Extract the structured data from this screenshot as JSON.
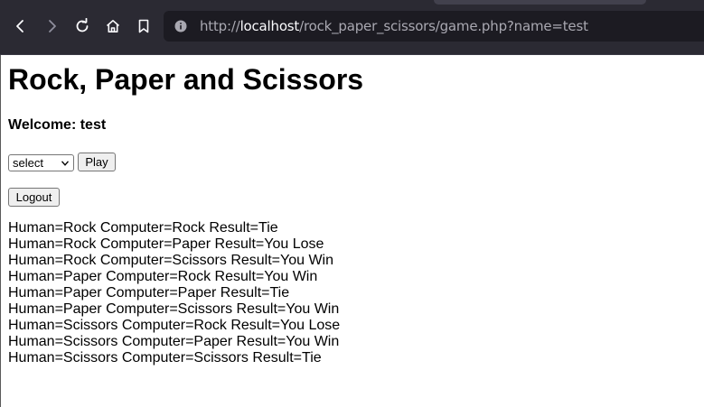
{
  "browser": {
    "url_prefix": "http://",
    "url_host": "localhost",
    "url_path": "/rock_paper_scissors/game.php?name=test"
  },
  "page": {
    "title": "Rock, Paper and Scissors",
    "welcome": "Welcome: test",
    "select_value": "select",
    "play_label": "Play",
    "logout_label": "Logout"
  },
  "results": [
    "Human=Rock Computer=Rock Result=Tie",
    "Human=Rock Computer=Paper Result=You Lose",
    "Human=Rock Computer=Scissors Result=You Win",
    "Human=Paper Computer=Rock Result=You Win",
    "Human=Paper Computer=Paper Result=Tie",
    "Human=Paper Computer=Scissors Result=You Win",
    "Human=Scissors Computer=Rock Result=You Lose",
    "Human=Scissors Computer=Paper Result=You Win",
    "Human=Scissors Computer=Scissors Result=Tie"
  ],
  "icons": {
    "back": "back-arrow-icon",
    "forward": "forward-arrow-icon",
    "reload": "reload-icon",
    "home": "home-icon",
    "bookmark": "bookmark-icon",
    "site_info": "site-info-icon"
  }
}
